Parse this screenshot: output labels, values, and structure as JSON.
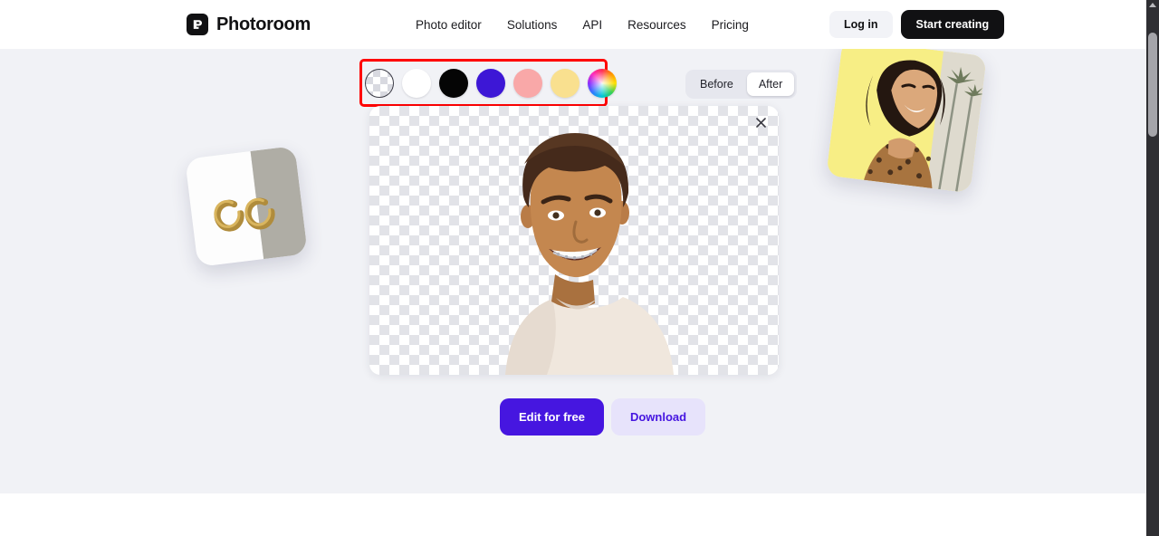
{
  "header": {
    "brand": {
      "name": "Photoroom",
      "logo_icon": "photoroom-logo-icon"
    },
    "nav": [
      {
        "label": "Photo editor"
      },
      {
        "label": "Solutions"
      },
      {
        "label": "API"
      },
      {
        "label": "Resources"
      },
      {
        "label": "Pricing"
      }
    ],
    "login_label": "Log in",
    "start_label": "Start creating"
  },
  "hero": {
    "swatches": [
      {
        "name": "transparent",
        "color": "transparent"
      },
      {
        "name": "white",
        "color": "#ffffff"
      },
      {
        "name": "black",
        "color": "#050505"
      },
      {
        "name": "purple",
        "color": "#3d17d6"
      },
      {
        "name": "pink",
        "color": "#f9a8a8"
      },
      {
        "name": "yellow",
        "color": "#f9e08f"
      },
      {
        "name": "custom-color-picker",
        "color": "rainbow"
      }
    ],
    "toggle": {
      "before_label": "Before",
      "after_label": "After",
      "selected": "After"
    },
    "canvas": {
      "close_icon": "close-icon",
      "subject_alt": "Smiling young man with braces in a cream t-shirt, background removed"
    },
    "actions": {
      "edit_label": "Edit for free",
      "download_label": "Download"
    },
    "preview_left_alt": "Gold hoop earrings on a white and gray split background",
    "preview_right_alt": "Smiling woman with dark hair on a yellow background with palm trees"
  },
  "colors": {
    "accent": "#4616e0",
    "accent_soft": "#e7e3fb",
    "highlight": "#ff0000",
    "hero_bg": "#f1f2f6",
    "dark": "#111113"
  },
  "scrollbar": {
    "arrow_icon": "scroll-up-arrow-icon"
  }
}
